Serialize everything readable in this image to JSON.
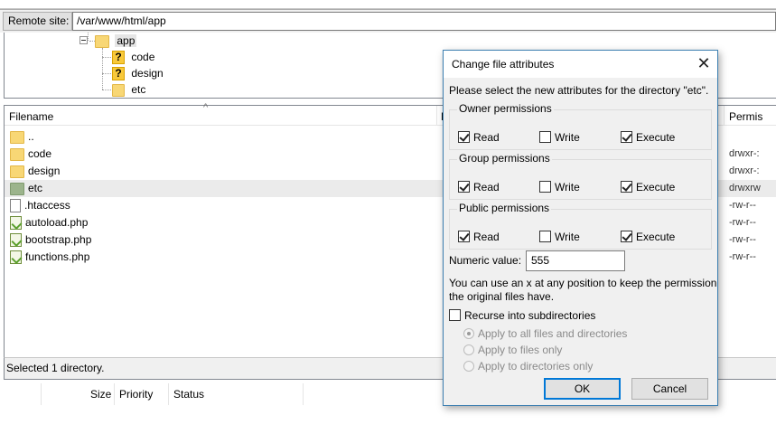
{
  "remote": {
    "label": "Remote site:",
    "path": "/var/www/html/app"
  },
  "tree": {
    "root": "app",
    "children": [
      {
        "label": "code",
        "icon": "question-folder-icon"
      },
      {
        "label": "design",
        "icon": "question-folder-icon"
      },
      {
        "label": "etc",
        "icon": "folder-icon"
      }
    ]
  },
  "filelist": {
    "columns": {
      "filename": "Filename",
      "filesize_partial": "F",
      "permissions_partial": "Permis"
    },
    "rows": [
      {
        "name": "..",
        "icon": "folder-icon",
        "perm": ""
      },
      {
        "name": "code",
        "icon": "folder-icon",
        "perm": "drwxr-:"
      },
      {
        "name": "design",
        "icon": "folder-icon",
        "perm": "drwxr-:"
      },
      {
        "name": "etc",
        "icon": "folder-icon",
        "perm": "drwxrw"
      },
      {
        "name": ".htaccess",
        "icon": "file-icon",
        "perm": "-rw-r--"
      },
      {
        "name": "autoload.php",
        "icon": "php-file-icon",
        "perm": "-rw-r--"
      },
      {
        "name": "bootstrap.php",
        "icon": "php-file-icon",
        "perm": "-rw-r--"
      },
      {
        "name": "functions.php",
        "icon": "php-file-icon",
        "perm": "-rw-r--"
      }
    ]
  },
  "status": {
    "text": "Selected 1 directory."
  },
  "queue": {
    "columns": {
      "size": "Size",
      "priority": "Priority",
      "status": "Status"
    }
  },
  "dialog": {
    "title": "Change file attributes",
    "close_glyph": "✕",
    "prompt": "Please select the new attributes for the directory \"etc\".",
    "groups": [
      {
        "label": "Owner permissions",
        "read": "Read",
        "write": "Write",
        "execute": "Execute",
        "read_checked": true,
        "write_checked": false,
        "execute_checked": true
      },
      {
        "label": "Group permissions",
        "read": "Read",
        "write": "Write",
        "execute": "Execute",
        "read_checked": true,
        "write_checked": false,
        "execute_checked": true
      },
      {
        "label": "Public permissions",
        "read": "Read",
        "write": "Write",
        "execute": "Execute",
        "read_checked": true,
        "write_checked": false,
        "execute_checked": true
      }
    ],
    "numeric_label": "Numeric value:",
    "numeric_value": "555",
    "hint_line1": "You can use an x at any position to keep the permission",
    "hint_line2": "the original files have.",
    "recurse_label": "Recurse into subdirectories",
    "recurse_checked": false,
    "apply_options": [
      {
        "label": "Apply to all files and directories",
        "selected": true
      },
      {
        "label": "Apply to files only",
        "selected": false
      },
      {
        "label": "Apply to directories only",
        "selected": false
      }
    ],
    "ok_label": "OK",
    "cancel_label": "Cancel"
  }
}
